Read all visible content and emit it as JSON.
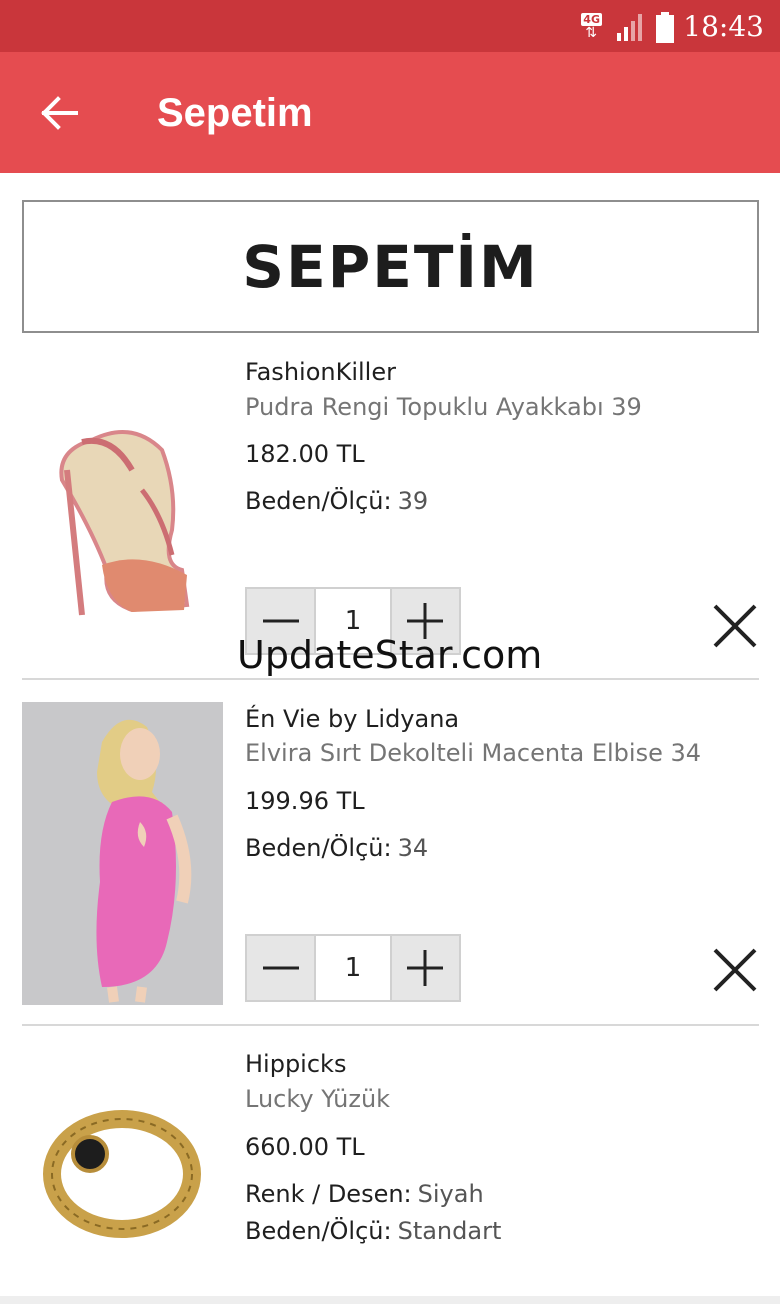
{
  "status_bar": {
    "network_label": "4G",
    "time": "18:43"
  },
  "app_bar": {
    "title": "Sepetim",
    "back_icon": "arrow-left-icon"
  },
  "header": {
    "title": "SEPETİM"
  },
  "cart_items": [
    {
      "brand": "FashionKiller",
      "description": "Pudra Rengi Topuklu Ayakkabı 39",
      "price": "182.00 TL",
      "attributes": [
        {
          "label": "Beden/Ölçü:",
          "value": "39"
        }
      ],
      "quantity": "1",
      "image_icon": "high-heel-sandal-image"
    },
    {
      "brand": "Én Vie by Lidyana",
      "description": "Elvira Sırt Dekolteli Macenta Elbise 34",
      "price": "199.96 TL",
      "attributes": [
        {
          "label": "Beden/Ölçü:",
          "value": "34"
        }
      ],
      "quantity": "1",
      "image_icon": "pink-dress-model-image"
    },
    {
      "brand": "Hippicks",
      "description": "Lucky Yüzük",
      "price": "660.00 TL",
      "attributes": [
        {
          "label": "Renk / Desen:",
          "value": "Siyah"
        },
        {
          "label": "Beden/Ölçü:",
          "value": "Standart"
        }
      ],
      "image_icon": "gold-ring-image"
    }
  ],
  "watermark": "UpdateStar.com",
  "colors": {
    "status_bar": "#c9363b",
    "app_bar": "#e54c50",
    "stepper_button": "#e6e6e6"
  }
}
